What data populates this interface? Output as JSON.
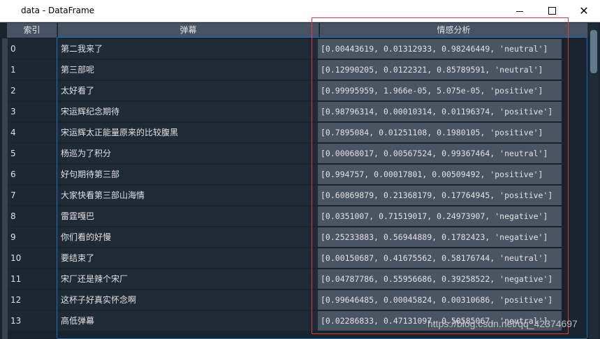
{
  "window": {
    "title": "data - DataFrame"
  },
  "table": {
    "columns": [
      "索引",
      "弹幕",
      "情感分析"
    ],
    "rows": [
      {
        "index": "0",
        "danmu": "第二我来了",
        "sentiment": "[0.00443619, 0.01312933, 0.98246449, 'neutral']"
      },
      {
        "index": "1",
        "danmu": "第三部呢",
        "sentiment": "[0.12990205, 0.0122321, 0.85789591, 'neutral']"
      },
      {
        "index": "2",
        "danmu": "太好看了",
        "sentiment": "[0.99995959, 1.966e-05, 5.075e-05, 'positive']"
      },
      {
        "index": "3",
        "danmu": "宋运辉纪念期待",
        "sentiment": "[0.98796314, 0.00010314, 0.01196374, 'positive']"
      },
      {
        "index": "4",
        "danmu": "宋运辉太正能量原来的比较腹黑",
        "sentiment": "[0.7895084, 0.01251108, 0.1980105, 'positive']"
      },
      {
        "index": "5",
        "danmu": "杨巡为了积分",
        "sentiment": "[0.00068017, 0.00567524, 0.99367464, 'neutral']"
      },
      {
        "index": "6",
        "danmu": "好句期待第三部",
        "sentiment": "[0.994757, 0.00017801, 0.00509492, 'positive']"
      },
      {
        "index": "7",
        "danmu": "大家快看第三部山海情",
        "sentiment": "[0.60869879, 0.21368179, 0.17764945, 'positive']"
      },
      {
        "index": "8",
        "danmu": "雷霆嘎巴",
        "sentiment": "[0.0351007, 0.71519017, 0.24973907, 'negative']"
      },
      {
        "index": "9",
        "danmu": "你们看的好慢",
        "sentiment": "[0.25233883, 0.56944889, 0.1782423, 'negative']"
      },
      {
        "index": "10",
        "danmu": "要结束了",
        "sentiment": "[0.00150687, 0.41675562, 0.58176744, 'neutral']"
      },
      {
        "index": "11",
        "danmu": "宋厂还是辣个宋厂",
        "sentiment": "[0.04787786, 0.55956686, 0.39258522, 'negative']"
      },
      {
        "index": "12",
        "danmu": "这杯子好真实怀念啊",
        "sentiment": "[0.99646485, 0.00045824, 0.00310686, 'positive']"
      },
      {
        "index": "13",
        "danmu": "高低弹幕",
        "sentiment": "[0.02286833, 0.47131097, 0.50585067, 'neutral']"
      }
    ]
  },
  "watermark": "https://blog.csdn.net/qq_42374697",
  "colors": {
    "background": "#19232d",
    "header": "#455364",
    "sentiment_cell": "#4a5563",
    "selection_border": "#1a72bb",
    "annotation_border": "#e23b3b"
  }
}
